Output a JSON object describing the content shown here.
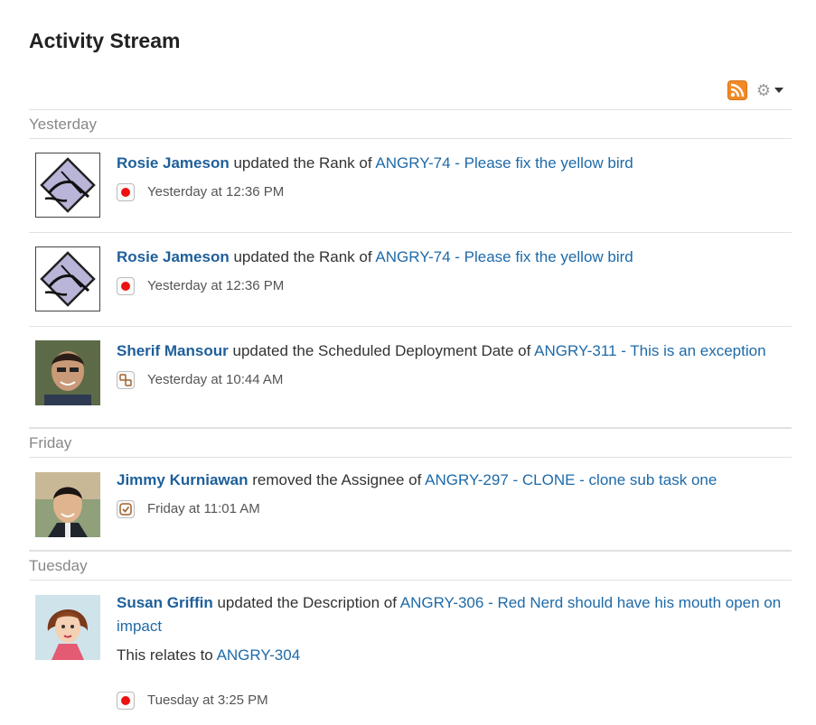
{
  "header": {
    "title": "Activity Stream"
  },
  "toolbar": {
    "rss_icon": "rss-feed-icon",
    "gear_icon": "gear-icon"
  },
  "groups": [
    {
      "label": "Yesterday"
    },
    {
      "label": "Friday"
    },
    {
      "label": "Tuesday"
    }
  ],
  "items": [
    {
      "user": "Rosie Jameson",
      "action": "updated the Rank of",
      "issue": "ANGRY-74 - Please fix the yellow bird",
      "time": "Yesterday at 12:36 PM",
      "type_icon": "bug-icon"
    },
    {
      "user": "Rosie Jameson",
      "action": "updated the Rank of",
      "issue": "ANGRY-74 - Please fix the yellow bird",
      "time": "Yesterday at 12:36 PM",
      "type_icon": "bug-icon"
    },
    {
      "user": "Sherif Mansour",
      "action": "updated the Scheduled Deployment Date of",
      "issue": "ANGRY-311 - This is an exception",
      "time": "Yesterday at 10:44 AM",
      "type_icon": "subtask-icon"
    },
    {
      "user": "Jimmy Kurniawan",
      "action": "removed the Assignee of",
      "issue": "ANGRY-297 - CLONE - clone sub task one",
      "time": "Friday at 11:01 AM",
      "type_icon": "task-icon"
    },
    {
      "user": "Susan Griffin",
      "action": "updated the Description of",
      "issue": "ANGRY-306 - Red Nerd should have his mouth open on impact",
      "extra_text": "This relates to",
      "extra_link": "ANGRY-304",
      "time": "Tuesday at 3:25 PM",
      "type_icon": "bug-icon"
    }
  ]
}
